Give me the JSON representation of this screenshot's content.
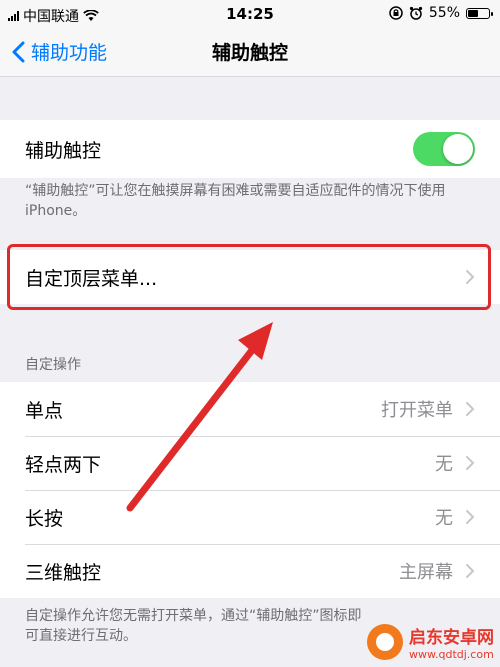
{
  "status_bar": {
    "carrier": "中国联通",
    "time": "14:25",
    "battery_percent": "55%",
    "battery_level": 0.55
  },
  "nav": {
    "back_label": "辅助功能",
    "title": "辅助触控"
  },
  "assistive_touch": {
    "label": "辅助触控",
    "enabled": true,
    "description": "“辅助触控”可让您在触摸屏幕有困难或需要自适应配件的情况下使用 iPhone。"
  },
  "customize_menu": {
    "label": "自定顶层菜单..."
  },
  "custom_actions": {
    "header": "自定操作",
    "items": [
      {
        "label": "单点",
        "value": "打开菜单"
      },
      {
        "label": "轻点两下",
        "value": "无"
      },
      {
        "label": "长按",
        "value": "无"
      },
      {
        "label": "三维触控",
        "value": "主屏幕"
      }
    ],
    "footer": "自定操作允许您无需打开菜单，通过“辅助触控”图标即可直接进行互动。"
  },
  "watermark": {
    "title": "启东安卓网",
    "url": "www.qdtdj.com"
  },
  "colors": {
    "accent": "#007aff",
    "toggle_on": "#4cd964",
    "annotation": "#e02a2a"
  }
}
